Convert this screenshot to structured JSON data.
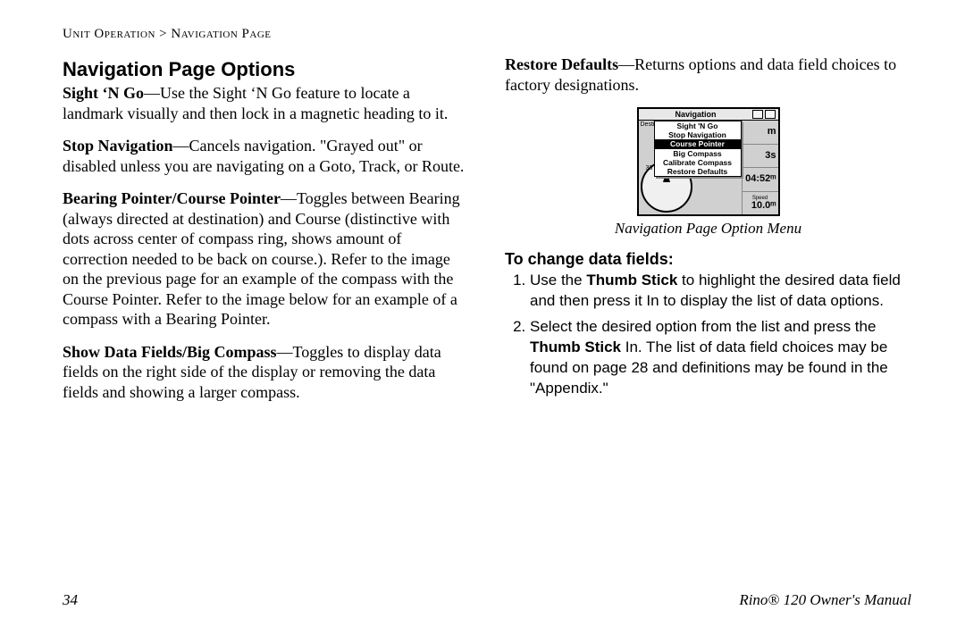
{
  "breadcrumb": {
    "section": "Unit Operation",
    "sep": " > ",
    "page": "Navigation Page"
  },
  "heading": "Navigation Page Options",
  "left": {
    "p1_b": "Sight ‘N Go",
    "p1": "—Use the Sight ‘N Go feature to locate a landmark visually and then lock in a magnetic heading to it.",
    "p2_b": "Stop Navigation",
    "p2": "—Cancels navigation. \"Grayed out\" or disabled unless you are navigating on a Goto, Track, or Route.",
    "p3_b": "Bearing Pointer/Course Pointer",
    "p3": "—Toggles between Bearing (always directed at destination) and Course (distinctive with dots across center of compass ring, shows amount of correction needed to be back on course.). Refer to the image on the previous page for an example of the compass with the Course Pointer. Refer to the image below for an example of a compass with a Bearing Pointer.",
    "p4_b": "Show Data Fields/Big Compass",
    "p4": "—Toggles to display data fields on the right side of the display or removing the data fields and showing a larger compass."
  },
  "right": {
    "p1_b": "Restore Defaults",
    "p1": "—Returns options and data field choices to factory designations.",
    "caption": "Navigation Page Option Menu",
    "subhead": "To change data fields:",
    "step1_a": "Use the ",
    "step1_b": "Thumb Stick",
    "step1_c": " to highlight the desired data field and then press it In to display the list of data options.",
    "step2_a": "Select the desired option from the list and press the ",
    "step2_b": "Thumb Stick",
    "step2_c": " In. The list of data field choices may be found on page 28 and definitions may be found in the \"Appendix.\""
  },
  "device": {
    "title": "Navigation",
    "dest": "Destina",
    "menu": {
      "i0": "Sight 'N Go",
      "i1": "Stop Navigation",
      "i2": "Course Pointer",
      "i3": "Big Compass",
      "i4": "Calibrate Compass",
      "i5": "Restore Defaults"
    },
    "fields": {
      "f1_label": "",
      "f1_val": "m",
      "f2_label": "",
      "f2_val": "3s",
      "f3_label": "",
      "f3_val": "04:52ᵐ",
      "f4_label": "Speed",
      "f4_val": "10.0ᵐ"
    }
  },
  "footer": {
    "page_num": "34",
    "manual": "Rino® 120 Owner's Manual"
  }
}
